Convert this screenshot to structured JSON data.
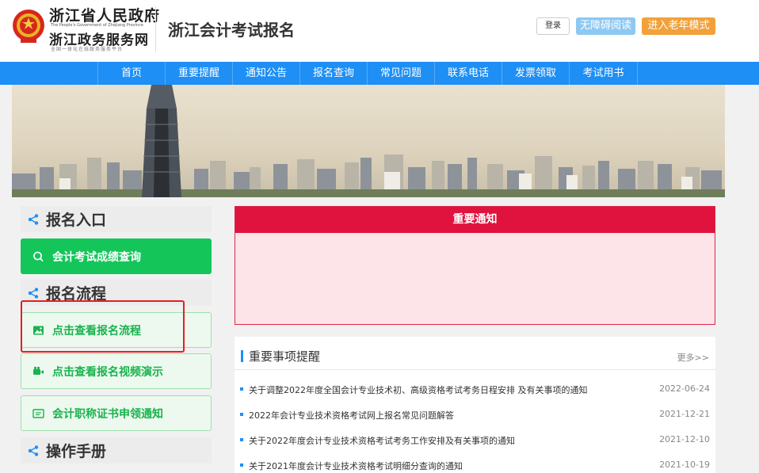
{
  "header": {
    "gov_title": "浙江省人民政府",
    "gov_subtitle_en": "The People's Government of Zhejiang Province",
    "gov_site": "浙江政务服务网",
    "gov_slogan": "全国一体化在线政务服务平台",
    "site_title": "浙江会计考试报名",
    "login_label": "登录",
    "accessibility_label": "无障碍阅读",
    "elder_mode_label": "进入老年模式"
  },
  "nav": {
    "items": [
      {
        "label": "首页"
      },
      {
        "label": "重要提醒"
      },
      {
        "label": "通知公告"
      },
      {
        "label": "报名查询"
      },
      {
        "label": "常见问题"
      },
      {
        "label": "联系电话"
      },
      {
        "label": "发票领取"
      },
      {
        "label": "考试用书"
      }
    ]
  },
  "sidebar": {
    "section_entry": "报名入口",
    "score_query": "会计考试成绩查询",
    "section_flow": "报名流程",
    "view_flow": "点击查看报名流程",
    "view_video": "点击查看报名视频演示",
    "cert_notice": "会计职称证书申领通知",
    "section_manual": "操作手册"
  },
  "notice": {
    "title": "重要通知"
  },
  "matters": {
    "title": "重要事项提醒",
    "more": "更多>>",
    "items": [
      {
        "title": "关于调整2022年度全国会计专业技术初、高级资格考试考务日程安排 及有关事项的通知",
        "date": "2022-06-24"
      },
      {
        "title": "2022年会计专业技术资格考试网上报名常见问题解答",
        "date": "2021-12-21"
      },
      {
        "title": "关于2022年度会计专业技术资格考试考务工作安排及有关事项的通知",
        "date": "2021-12-10"
      },
      {
        "title": "关于2021年度会计专业技术资格考试明细分查询的通知",
        "date": "2021-10-19"
      }
    ]
  },
  "colors": {
    "nav_blue": "#1e8ff5",
    "notice_red": "#e0123e",
    "green": "#14c65a",
    "elder_orange": "#f2a13a",
    "access_blue": "#8dc8f2"
  },
  "icons": {
    "emblem": "national-emblem",
    "share": "share-icon",
    "search": "search-icon",
    "image": "image-icon",
    "video": "video-camera-icon",
    "certificate": "certificate-icon"
  }
}
